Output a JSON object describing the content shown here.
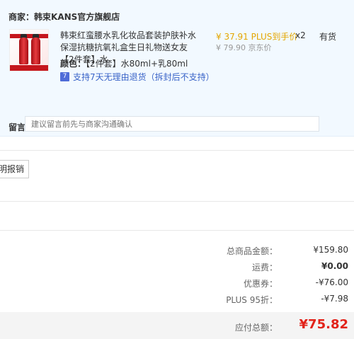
{
  "merchant": {
    "label": "商家：",
    "name": "韩束KANS官方旗舰店"
  },
  "product": {
    "name": "韩束红蛮腰水乳化妆品套装护肤补水保湿抗糖抗氧礼盒生日礼物送女友 【2件套】水",
    "attr_label": "颜色：",
    "attr_value": "【2件套】水80ml+乳80ml",
    "service_icon": "7",
    "service": "支持7天无理由退货（拆封后不支持）",
    "price": "¥ 37.91 PLUS到手价",
    "original_price": "¥ 79.90 京东价",
    "quantity": "x2",
    "stock": "有货"
  },
  "note": {
    "label": "留言：",
    "placeholder": "建议留言前先与商家沟通确认"
  },
  "invoice": {
    "button": "明报销"
  },
  "summary": {
    "rows": [
      {
        "label": "总商品金额：",
        "value": "¥159.80"
      },
      {
        "label": "运费：",
        "value": "¥0.00"
      },
      {
        "label": "优惠券：",
        "value": "-¥76.00"
      },
      {
        "label": "PLUS 95折：",
        "value": "-¥7.98"
      }
    ],
    "total_label": "应付总额：",
    "total_value": "¥75.82"
  },
  "colors": {
    "accent_red": "#e2231a",
    "plus_gold": "#e4a600",
    "service_blue": "#3a64c8",
    "panel_bg": "#f2f9ff"
  }
}
